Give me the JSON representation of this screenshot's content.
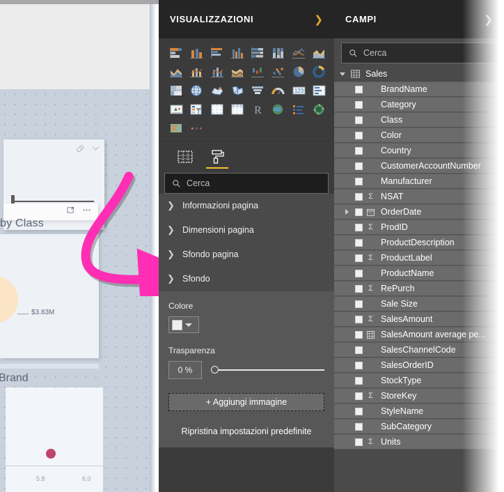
{
  "canvas": {
    "slicer": {
      "eraser_icon": "eraser-icon",
      "chevron_icon": "chevron-down-icon",
      "focus_icon": "focus-mode-icon",
      "more_icon": "more-options-icon"
    },
    "labels": {
      "by_class": "by Class",
      "value": "$3.83M",
      "brand": "Brand"
    },
    "scatter": {
      "tick_left": "5.8",
      "tick_right": "6.0",
      "point_color": "#bf456a"
    },
    "arrow_color": "#ff2eb4"
  },
  "visualizations": {
    "title": "VISUALIZZAZIONI",
    "collapse_icon": "chevron-right-icon",
    "icons": [
      "stacked-bar-chart-icon",
      "stacked-column-chart-icon",
      "clustered-bar-chart-icon",
      "clustered-column-chart-icon",
      "100-stacked-bar-chart-icon",
      "100-stacked-column-chart-icon",
      "line-chart-icon",
      "area-chart-icon",
      "stacked-area-chart-icon",
      "line-stacked-column-icon",
      "line-clustered-column-icon",
      "ribbon-chart-icon",
      "waterfall-chart-icon",
      "scatter-chart-icon",
      "pie-chart-icon",
      "donut-chart-icon",
      "treemap-icon",
      "map-icon",
      "filled-map-icon",
      "shape-map-icon",
      "funnel-icon",
      "gauge-icon",
      "card-icon",
      "multi-row-card-icon",
      "kpi-icon",
      "slicer-icon",
      "table-icon",
      "matrix-icon",
      "r-script-visual-icon",
      "arcgis-map-icon",
      "key-influencers-icon",
      "decomposition-tree-icon",
      "paginated-report-icon",
      "more-visuals-icon"
    ],
    "tabs": [
      {
        "name": "fields-tab",
        "icon": "fields-grid-icon",
        "active": false
      },
      {
        "name": "format-tab",
        "icon": "paint-roller-icon",
        "active": true
      }
    ],
    "search": {
      "placeholder": "Cerca",
      "icon": "search-icon"
    },
    "sections": [
      {
        "label": "Informazioni pagina",
        "expanded": false,
        "icon": "chevron-right-icon"
      },
      {
        "label": "Dimensioni pagina",
        "expanded": false,
        "icon": "chevron-right-icon"
      },
      {
        "label": "Sfondo pagina",
        "expanded": false,
        "icon": "chevron-right-icon"
      },
      {
        "label": "Sfondo",
        "expanded": true,
        "icon": "chevron-down-icon"
      }
    ],
    "sfondo": {
      "color_label": "Colore",
      "color_value": "#f0f0f0",
      "color_dropdown_icon": "chevron-down-icon",
      "transparency_label": "Trasparenza",
      "transparency_value": "0 %",
      "transparency_slider_pct": 0,
      "add_image_label": "+ Aggiungi immagine",
      "reset_label": "Ripristina impostazioni predefinite"
    },
    "accent_color": "#f2c230"
  },
  "fields": {
    "title": "CAMPI",
    "collapse_icon": "chevron-right-icon",
    "search": {
      "placeholder": "Cerca",
      "icon": "search-icon"
    },
    "table": {
      "name": "Sales",
      "icon": "table-icon",
      "expand_icon": "triangle-down-icon"
    },
    "items": [
      {
        "label": "BrandName",
        "sigma": false,
        "date": false,
        "expandable": false,
        "calc": false
      },
      {
        "label": "Category",
        "sigma": false,
        "date": false,
        "expandable": false,
        "calc": false
      },
      {
        "label": "Class",
        "sigma": false,
        "date": false,
        "expandable": false,
        "calc": false
      },
      {
        "label": "Color",
        "sigma": false,
        "date": false,
        "expandable": false,
        "calc": false
      },
      {
        "label": "Country",
        "sigma": false,
        "date": false,
        "expandable": false,
        "calc": false
      },
      {
        "label": "CustomerAccountNumber",
        "sigma": false,
        "date": false,
        "expandable": false,
        "calc": false
      },
      {
        "label": "Manufacturer",
        "sigma": false,
        "date": false,
        "expandable": false,
        "calc": false
      },
      {
        "label": "NSAT",
        "sigma": true,
        "date": false,
        "expandable": false,
        "calc": false
      },
      {
        "label": "OrderDate",
        "sigma": false,
        "date": true,
        "expandable": true,
        "calc": false
      },
      {
        "label": "ProdID",
        "sigma": true,
        "date": false,
        "expandable": false,
        "calc": false
      },
      {
        "label": "ProductDescription",
        "sigma": false,
        "date": false,
        "expandable": false,
        "calc": false
      },
      {
        "label": "ProductLabel",
        "sigma": true,
        "date": false,
        "expandable": false,
        "calc": false
      },
      {
        "label": "ProductName",
        "sigma": false,
        "date": false,
        "expandable": false,
        "calc": false
      },
      {
        "label": "RePurch",
        "sigma": true,
        "date": false,
        "expandable": false,
        "calc": false
      },
      {
        "label": "Sale Size",
        "sigma": false,
        "date": false,
        "expandable": false,
        "calc": false
      },
      {
        "label": "SalesAmount",
        "sigma": true,
        "date": false,
        "expandable": false,
        "calc": false
      },
      {
        "label": "SalesAmount average pe...",
        "sigma": false,
        "date": false,
        "expandable": false,
        "calc": true
      },
      {
        "label": "SalesChannelCode",
        "sigma": false,
        "date": false,
        "expandable": false,
        "calc": false
      },
      {
        "label": "SalesOrderID",
        "sigma": false,
        "date": false,
        "expandable": false,
        "calc": false
      },
      {
        "label": "StockType",
        "sigma": false,
        "date": false,
        "expandable": false,
        "calc": false
      },
      {
        "label": "StoreKey",
        "sigma": true,
        "date": false,
        "expandable": false,
        "calc": false
      },
      {
        "label": "StyleName",
        "sigma": false,
        "date": false,
        "expandable": false,
        "calc": false
      },
      {
        "label": "SubCategory",
        "sigma": false,
        "date": false,
        "expandable": false,
        "calc": false
      },
      {
        "label": "Units",
        "sigma": true,
        "date": false,
        "expandable": false,
        "calc": false
      }
    ]
  }
}
